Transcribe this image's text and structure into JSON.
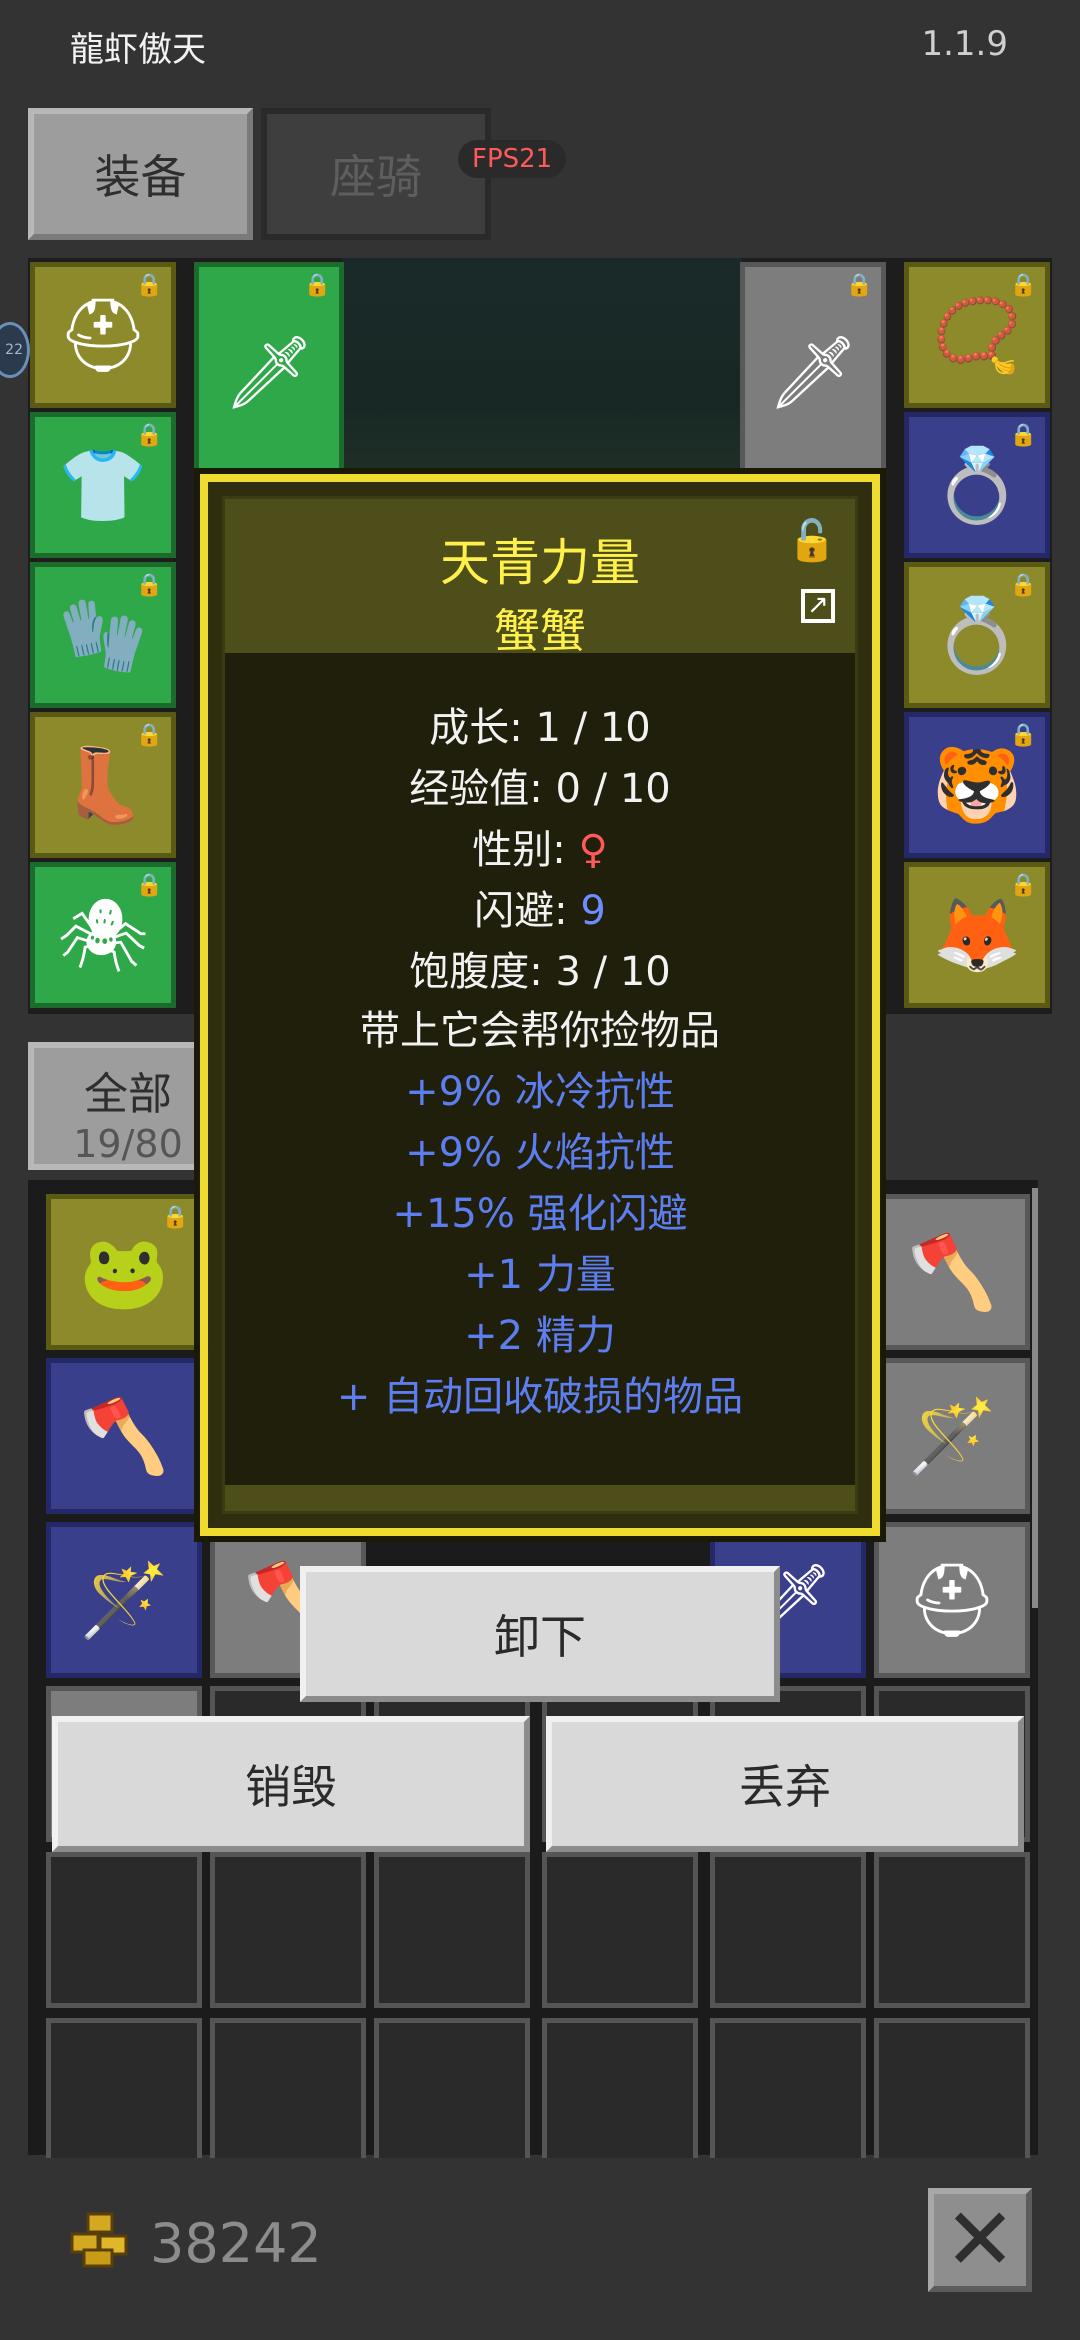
{
  "header": {
    "app_title": "龍虾傲天",
    "version": "1.1.9"
  },
  "tabs": [
    {
      "label": "装备"
    },
    {
      "label": "座骑"
    }
  ],
  "fps": "FPS21",
  "side_badge": "22",
  "filter": {
    "label": "全部",
    "count": "19/80"
  },
  "dialog": {
    "title": "天青力量",
    "subtitle": "蟹蟹",
    "stats": [
      {
        "label": "成长: ",
        "value": "1 / 10"
      },
      {
        "label": "经验值: ",
        "value": "0 / 10"
      },
      {
        "label": "性别: ",
        "value": "♀"
      },
      {
        "label": "闪避: ",
        "value": "9"
      },
      {
        "label": "饱腹度: ",
        "value": "3 / 10"
      }
    ],
    "description": "带上它会帮你捡物品",
    "bonuses": [
      "+9% 冰冷抗性",
      "+9% 火焰抗性",
      "+15% 强化闪避",
      "+1 力量",
      "+2 精力",
      "+ 自动回收破损的物品"
    ]
  },
  "buttons": {
    "unequip": "卸下",
    "destroy": "销毁",
    "drop": "丢弃"
  },
  "gold": "38242",
  "colors": {
    "dialog_border": "#f0dc2e",
    "title_yellow": "#fff14a",
    "bonus_blue": "#5d7ef0",
    "female_red": "#ff5a5a"
  }
}
